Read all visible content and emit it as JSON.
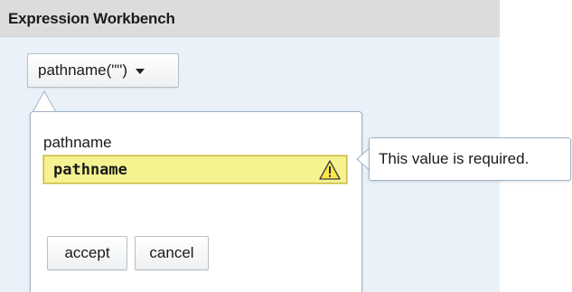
{
  "panel": {
    "title": "Expression Workbench"
  },
  "function_button": {
    "label": "pathname(\"\")",
    "icon": "caret-down-icon"
  },
  "editor": {
    "field_label": "pathname",
    "field_value": "pathname",
    "field_state": "invalid",
    "warning_icon": "warning-triangle-icon",
    "accept_label": "accept",
    "cancel_label": "cancel"
  },
  "tooltip": {
    "message": "This value is required."
  },
  "colors": {
    "header_bg": "#dcdcdc",
    "panel_bg": "#eaf1f9",
    "invalid_field_bg": "#f5f290",
    "popover_border": "#9fb4c8"
  }
}
